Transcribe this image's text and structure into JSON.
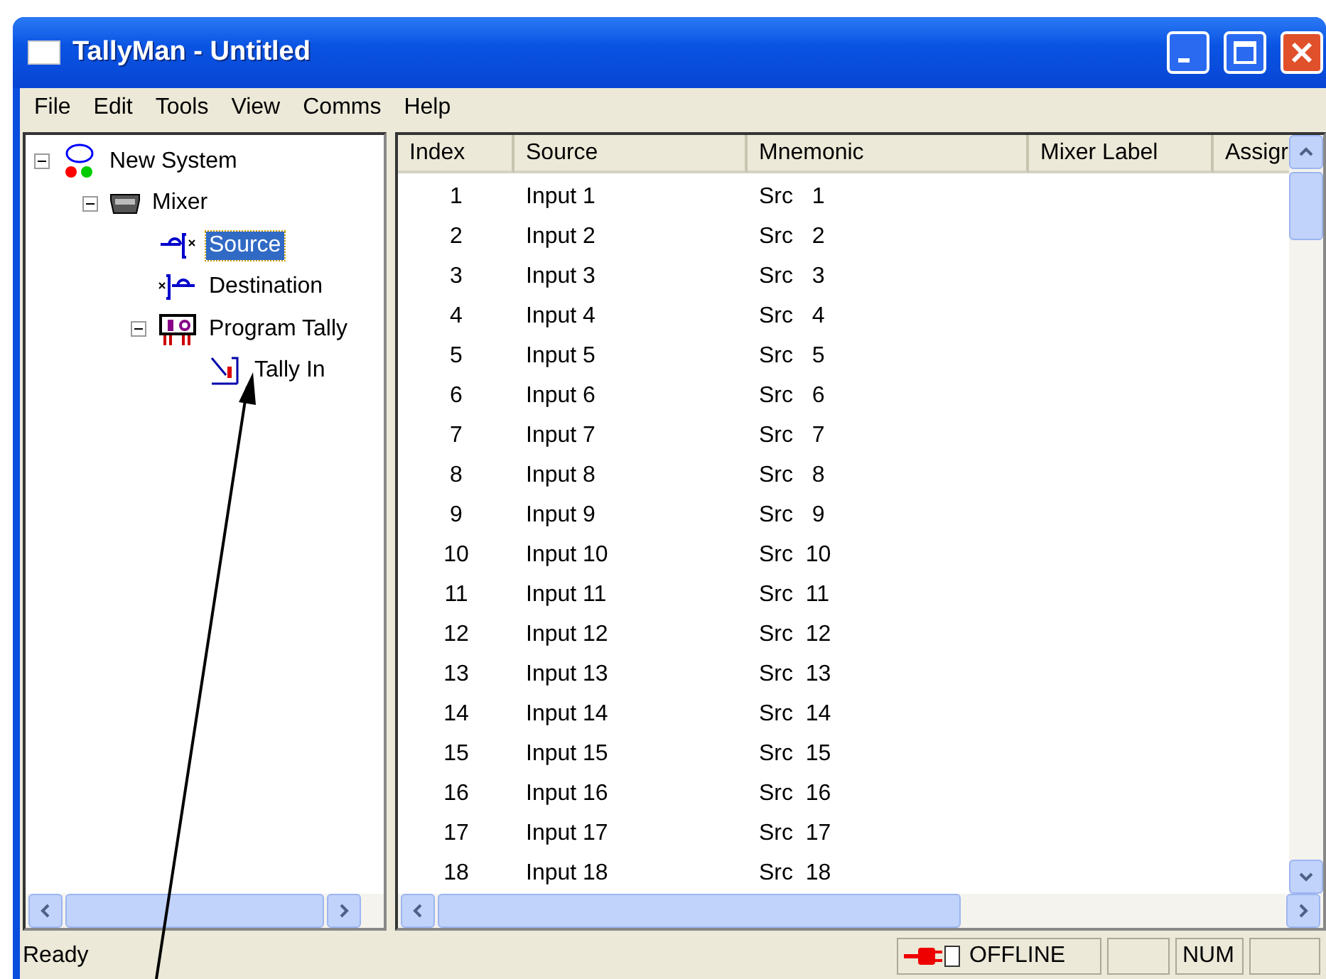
{
  "window": {
    "title": "TallyMan - Untitled"
  },
  "menu": [
    "File",
    "Edit",
    "Tools",
    "View",
    "Comms",
    "Help"
  ],
  "tree": [
    {
      "label": "New System",
      "kind": "system",
      "expanded": true,
      "selected": false,
      "children": [
        {
          "label": "Mixer",
          "kind": "mixer",
          "expanded": true,
          "selected": false,
          "children": [
            {
              "label": "Source",
              "kind": "source",
              "selected": true
            },
            {
              "label": "Destination",
              "kind": "destination",
              "selected": false
            },
            {
              "label": "Program Tally",
              "kind": "tally",
              "expanded": true,
              "selected": false,
              "children": [
                {
                  "label": "Tally In",
                  "kind": "tally-in",
                  "selected": false
                }
              ]
            }
          ]
        }
      ]
    }
  ],
  "table": {
    "columns": [
      "Index",
      "Source",
      "Mnemonic",
      "Mixer Label",
      "Assigr"
    ],
    "rows": [
      [
        "1",
        "Input 1",
        "Src   1"
      ],
      [
        "2",
        "Input 2",
        "Src   2"
      ],
      [
        "3",
        "Input 3",
        "Src   3"
      ],
      [
        "4",
        "Input 4",
        "Src   4"
      ],
      [
        "5",
        "Input 5",
        "Src   5"
      ],
      [
        "6",
        "Input 6",
        "Src   6"
      ],
      [
        "7",
        "Input 7",
        "Src   7"
      ],
      [
        "8",
        "Input 8",
        "Src   8"
      ],
      [
        "9",
        "Input 9",
        "Src   9"
      ],
      [
        "10",
        "Input 10",
        "Src  10"
      ],
      [
        "11",
        "Input 11",
        "Src  11"
      ],
      [
        "12",
        "Input 12",
        "Src  12"
      ],
      [
        "13",
        "Input 13",
        "Src  13"
      ],
      [
        "14",
        "Input 14",
        "Src  14"
      ],
      [
        "15",
        "Input 15",
        "Src  15"
      ],
      [
        "16",
        "Input 16",
        "Src  16"
      ],
      [
        "17",
        "Input 17",
        "Src  17"
      ],
      [
        "18",
        "Input 18",
        "Src  18"
      ]
    ]
  },
  "status_bar": {
    "message": "Ready",
    "connection": "OFFLINE",
    "num": "NUM"
  }
}
